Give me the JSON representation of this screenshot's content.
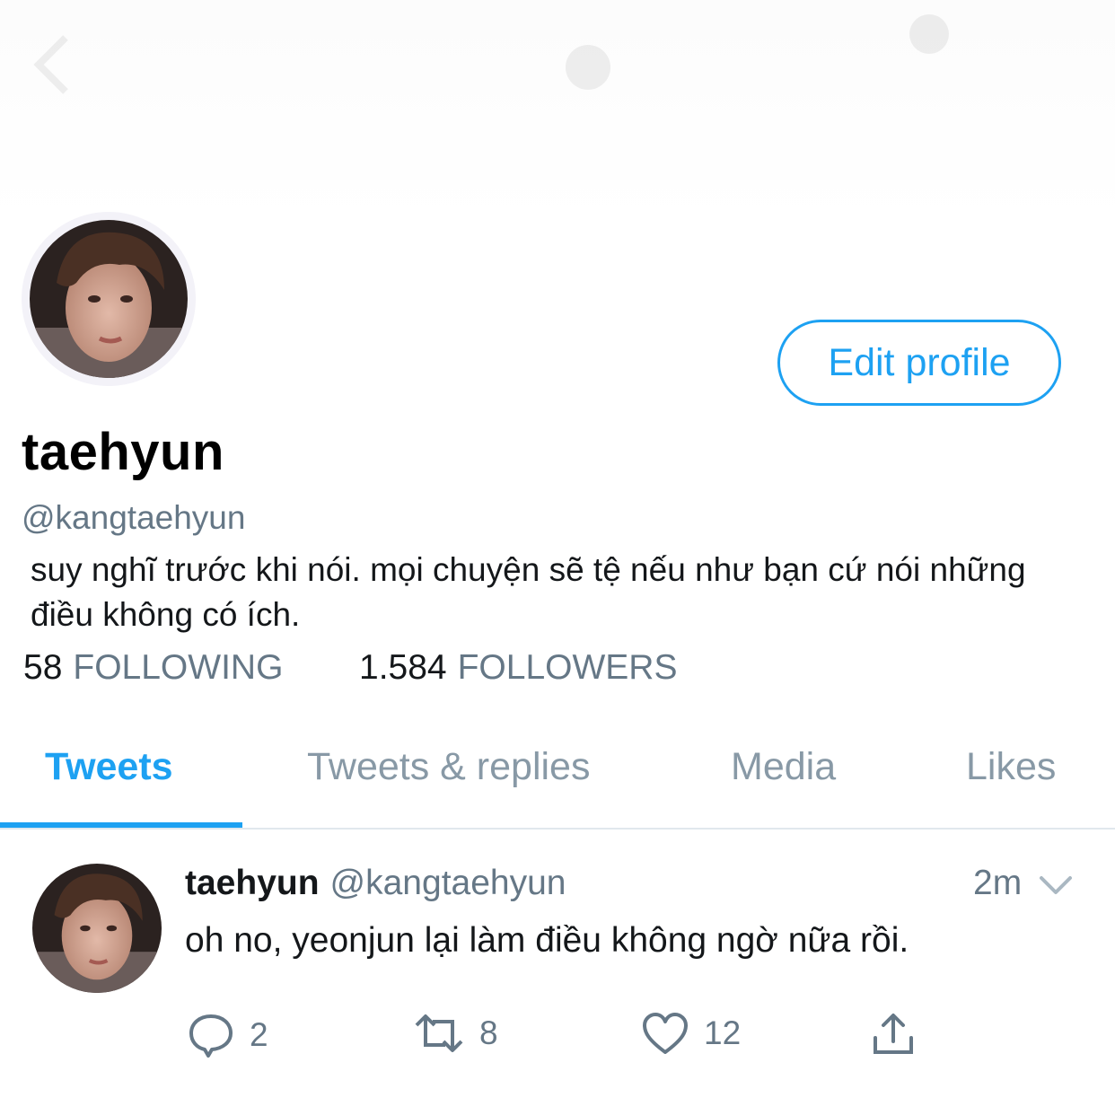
{
  "header": {
    "back_icon": "chevron-left-icon"
  },
  "profile": {
    "display_name": "taehyun",
    "handle": "@kangtaehyun",
    "bio": "suy nghĩ trước khi nói. mọi chuyện sẽ tệ nếu như bạn cứ nói những điều không có ích.",
    "edit_button": "Edit profile",
    "following_count": "58",
    "following_label": "FOLLOWING",
    "followers_count": "1.584",
    "followers_label": "FOLLOWERS"
  },
  "tabs": [
    {
      "label": "Tweets",
      "active": true
    },
    {
      "label": "Tweets & replies",
      "active": false
    },
    {
      "label": "Media",
      "active": false
    },
    {
      "label": "Likes",
      "active": false
    }
  ],
  "tweet": {
    "name": "taehyun",
    "handle": "@kangtaehyun",
    "time": "2m",
    "text": "oh no, yeonjun lại làm điều không ngờ nữa rồi.",
    "replies": "2",
    "retweets": "8",
    "likes": "12"
  },
  "colors": {
    "accent": "#1da1f2",
    "secondary_text": "#657786",
    "tab_inactive": "#8899a6"
  }
}
